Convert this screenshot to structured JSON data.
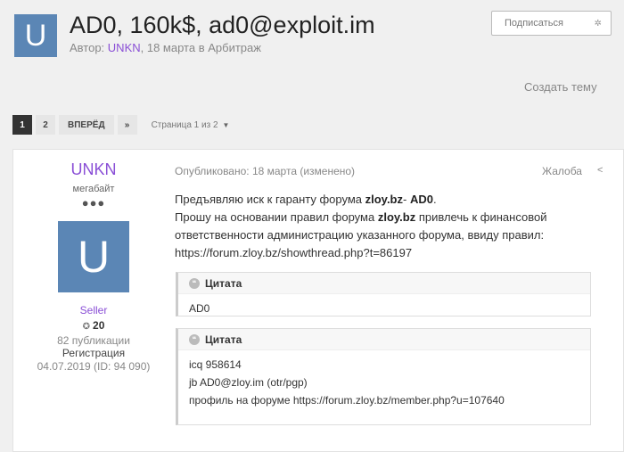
{
  "topic": {
    "avatar_letter": "U",
    "title": "AD0, 160k$, ad0@exploit.im",
    "meta_prefix": "Автор: ",
    "author": "UNKN",
    "meta_suffix": ", 18 марта в Арбитраж"
  },
  "follow_button": {
    "label": "Подписаться",
    "icon": "gear-icon"
  },
  "create_topic": "Создать тему",
  "pagination": {
    "pages": [
      "1",
      "2"
    ],
    "next_label": "ВПЕРЁД",
    "last_label": "»",
    "info": "Страница 1 из 2"
  },
  "post": {
    "author": {
      "name": "UNKN",
      "rank": "мегабайт",
      "pips": "●●●",
      "avatar_letter": "U",
      "group": "Seller",
      "reputation": "20",
      "posts": "82 публикации",
      "reg_label": "Регистрация",
      "reg": "04.07.2019 (ID: 94 090)"
    },
    "date": "Опубликовано: 18 марта (изменено)",
    "report": "Жалоба",
    "text": {
      "p1_pre": "Предъявляю иск к гаранту форума ",
      "p1_forum": "zloy.bz",
      "p1_dash": "- ",
      "p1_name": "AD0",
      "p1_end": ".",
      "p2_pre": "Прошу на основании правил форума ",
      "p2_forum": "zloy.bz",
      "p2_rest": " привлечь к финансовой ответственности администрацию указанного форума, ввиду правил: https://forum.zloy.bz/showthread.php?t=86197"
    },
    "quotes": [
      {
        "title": "Цитата",
        "lines": [
          "AD0"
        ]
      },
      {
        "title": "Цитата",
        "lines": [
          "icq 958614",
          "jb AD0@zloy.im (otr/pgp)",
          "профиль на форуме https://forum.zloy.bz/member.php?u=107640"
        ]
      }
    ]
  },
  "colors": {
    "accent": "#8a4fd6",
    "avatar": "#5b86b5",
    "active_page": "#333333"
  }
}
